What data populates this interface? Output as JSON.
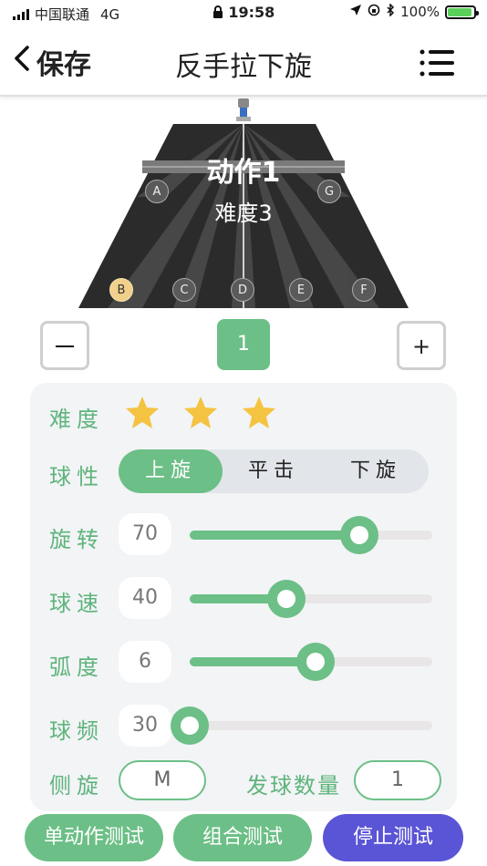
{
  "status_bar": {
    "carrier": "中国联通",
    "network": "4G",
    "time": "19:58",
    "battery": "100%"
  },
  "nav": {
    "back_label": "保存",
    "title": "反手拉下旋"
  },
  "table": {
    "action_title": "动作1",
    "action_subtitle": "难度3",
    "zones": [
      "A",
      "B",
      "C",
      "D",
      "E",
      "F",
      "G"
    ],
    "active_zone": "B"
  },
  "stepper": {
    "minus_label": "—",
    "value": "1",
    "plus_label": "+"
  },
  "settings": {
    "difficulty": {
      "label": "难度",
      "stars": 3
    },
    "spin_type": {
      "label": "球性",
      "options": [
        "上旋",
        "平击",
        "下旋"
      ],
      "selected": "上旋"
    },
    "rotation": {
      "label": "旋转",
      "value": "70",
      "fraction": 0.7
    },
    "speed": {
      "label": "球速",
      "value": "40",
      "fraction": 0.4
    },
    "arc": {
      "label": "弧度",
      "value": "6",
      "fraction": 0.52
    },
    "frequency": {
      "label": "球频",
      "value": "30",
      "fraction": 0.0
    },
    "side_spin": {
      "label": "侧旋",
      "value": "M"
    },
    "ball_count": {
      "label": "发球数量",
      "value": "1"
    }
  },
  "actions": {
    "single_test": "单动作测试",
    "combo_test": "组合测试",
    "stop_test": "停止测试"
  },
  "colors": {
    "accent": "#6cbf86",
    "stop_button": "#5a54d6",
    "star": "#f5c342",
    "table": "#2b2b2b"
  }
}
